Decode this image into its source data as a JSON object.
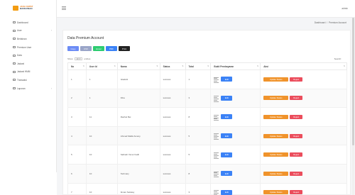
{
  "brand": {
    "line1": "JASA CEPAT",
    "line2": "BANGUNAN",
    "accent": "#f39c12"
  },
  "sidebar": {
    "items": [
      {
        "label": "Dashboard",
        "icon": "dashboard-icon",
        "chevron": false
      },
      {
        "label": "User",
        "icon": "user-icon",
        "chevron": true
      },
      {
        "label": "Berlainan",
        "icon": "list-icon",
        "chevron": false
      },
      {
        "label": "Premium User",
        "icon": "star-icon",
        "chevron": false
      },
      {
        "label": "Data",
        "icon": "data-icon",
        "chevron": false
      },
      {
        "label": "Jadwal",
        "icon": "calendar-icon",
        "chevron": false
      },
      {
        "label": "Jadwal HMM",
        "icon": "calendar-icon",
        "chevron": false
      },
      {
        "label": "Transaksi",
        "icon": "wallet-icon",
        "chevron": false
      },
      {
        "label": "Laporan",
        "icon": "report-icon",
        "chevron": true
      }
    ]
  },
  "topbar": {
    "user": "admin",
    "menu_icon": "hamburger-icon"
  },
  "breadcrumb": {
    "home": "Dashboard",
    "sep": "/",
    "current": "Premium Account"
  },
  "page": {
    "title": "Data Premium Account",
    "export_buttons": [
      {
        "label": "Copy",
        "color": "#6c8cf5"
      },
      {
        "label": "CSV",
        "color": "#9aa5c8"
      },
      {
        "label": "Excel",
        "color": "#2ecc71"
      },
      {
        "label": "PDF",
        "color": "#3b82f6"
      },
      {
        "label": "Print",
        "color": "#222222"
      }
    ],
    "show_label": "Show",
    "show_value": "10",
    "entries_label": "entries",
    "search_label": "Search:"
  },
  "table": {
    "headers": [
      "No",
      "User Id",
      "Nama",
      "Status",
      "Total",
      "Bukti Pembayaran",
      "Aksi"
    ],
    "edit_label": "Edit",
    "update_label": "Update Status",
    "reject_label": "Reject",
    "rows": [
      {
        "no": "1",
        "user_id": "1",
        "nama": "Istadoiti",
        "status": "success",
        "total": "1"
      },
      {
        "no": "2",
        "user_id": "1",
        "nama": "Fiba",
        "status": "success",
        "total": "3"
      },
      {
        "no": "3",
        "user_id": "11",
        "nama": "Rachel Bei",
        "status": "success",
        "total": "8"
      },
      {
        "no": "4",
        "user_id": "10",
        "nama": "Ahmad Maliki Amany",
        "status": "success",
        "total": "5"
      },
      {
        "no": "5",
        "user_id": "10",
        "nama": "Safinah Yanur Fadli",
        "status": "success",
        "total": "5"
      },
      {
        "no": "6",
        "user_id": "10",
        "nama": "Tazimary",
        "status": "success",
        "total": "8"
      },
      {
        "no": "7",
        "user_id": "10",
        "nama": "Ikman Setiawy",
        "status": "success",
        "total": "3"
      }
    ]
  }
}
